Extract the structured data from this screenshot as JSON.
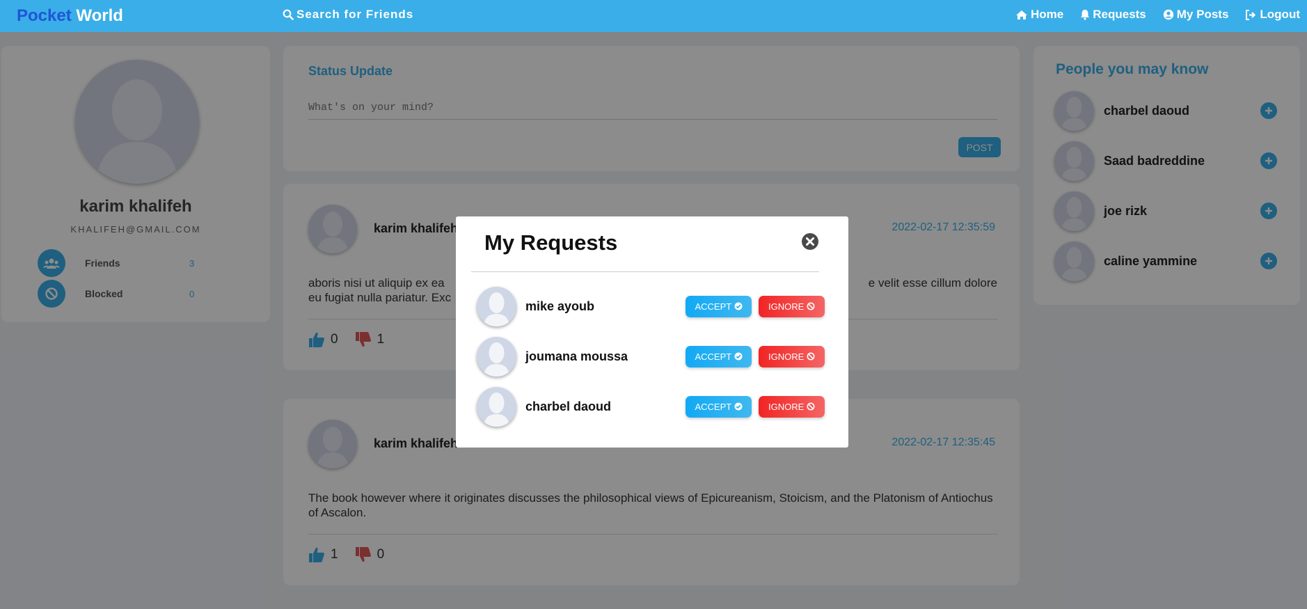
{
  "brand": {
    "part1": "Pocket",
    "part2": "World"
  },
  "nav": {
    "search_label": "Search for Friends",
    "links": [
      {
        "label": "Home",
        "icon": "home-icon"
      },
      {
        "label": "Requests",
        "icon": "bell-icon"
      },
      {
        "label": "My Posts",
        "icon": "user-circle-icon"
      },
      {
        "label": "Logout",
        "icon": "sign-out-icon"
      }
    ]
  },
  "profile": {
    "name": "karim khalifeh",
    "email": "KHALIFEH@GMAIL.COM",
    "stats": [
      {
        "label": "Friends",
        "value": "3",
        "icon": "users-icon"
      },
      {
        "label": "Blocked",
        "value": "0",
        "icon": "ban-icon"
      }
    ]
  },
  "status": {
    "title": "Status Update",
    "placeholder": "What's on your mind?",
    "post_label": "POST"
  },
  "posts": [
    {
      "author": "karim khalifeh",
      "date": "2022-02-17 12:35:59",
      "text_left": "aboris nisi ut aliquip ex ea",
      "text_right": "e velit esse cillum dolore",
      "text_line2": "eu fugiat nulla pariatur. Exc",
      "likes": "0",
      "dislikes": "1"
    },
    {
      "author": "karim khalifeh",
      "date": "2022-02-17 12:35:45",
      "text": "The book however where it originates discusses the philosophical views of Epicureanism, Stoicism, and the Platonism of Antiochus of Ascalon.",
      "likes": "1",
      "dislikes": "0"
    }
  ],
  "people_you_may_know": {
    "title": "People you may know",
    "people": [
      "charbel daoud",
      "Saad badreddine",
      "joe rizk",
      "caline yammine"
    ]
  },
  "modal": {
    "title": "My Requests",
    "requests": [
      {
        "name": "mike ayoub"
      },
      {
        "name": "joumana moussa"
      },
      {
        "name": "charbel daoud"
      }
    ],
    "accept_label": "ACCEPT",
    "ignore_label": "IGNORE"
  },
  "colors": {
    "accent": "#3aaee8",
    "brand_dark": "#1f56d6",
    "ignore": "#f12424"
  }
}
